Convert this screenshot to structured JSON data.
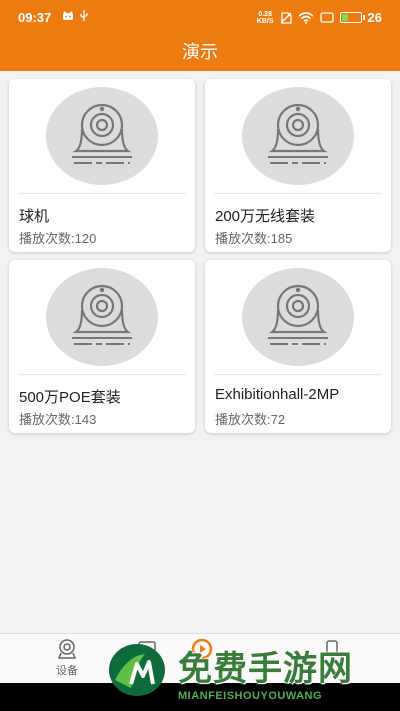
{
  "status_bar": {
    "time": "09:37",
    "net_speed_value": "0.28",
    "net_speed_unit": "KB/S",
    "battery_level": "26"
  },
  "app_bar": {
    "title": "演示"
  },
  "devices": [
    {
      "name": "球机",
      "plays_label": "播放次数:120"
    },
    {
      "name": "200万无线套装",
      "plays_label": "播放次数:185"
    },
    {
      "name": "500万POE套装",
      "plays_label": "播放次数:143"
    },
    {
      "name": "Exhibitionhall-2MP",
      "plays_label": "播放次数:72"
    }
  ],
  "bottom_nav": {
    "items": [
      {
        "label": "设备",
        "icon": "camera-icon"
      },
      {
        "label": "",
        "icon": "demo-icon"
      },
      {
        "label": "",
        "icon": "play-icon"
      },
      {
        "label": "",
        "icon": "profile-icon"
      }
    ]
  },
  "watermark": {
    "title": "免费手游网",
    "subtitle": "MIANFEISHOUYOUWANG"
  },
  "colors": {
    "accent": "#ee7b0f",
    "card_bg": "#ffffff",
    "page_bg": "#f2f2f2"
  }
}
